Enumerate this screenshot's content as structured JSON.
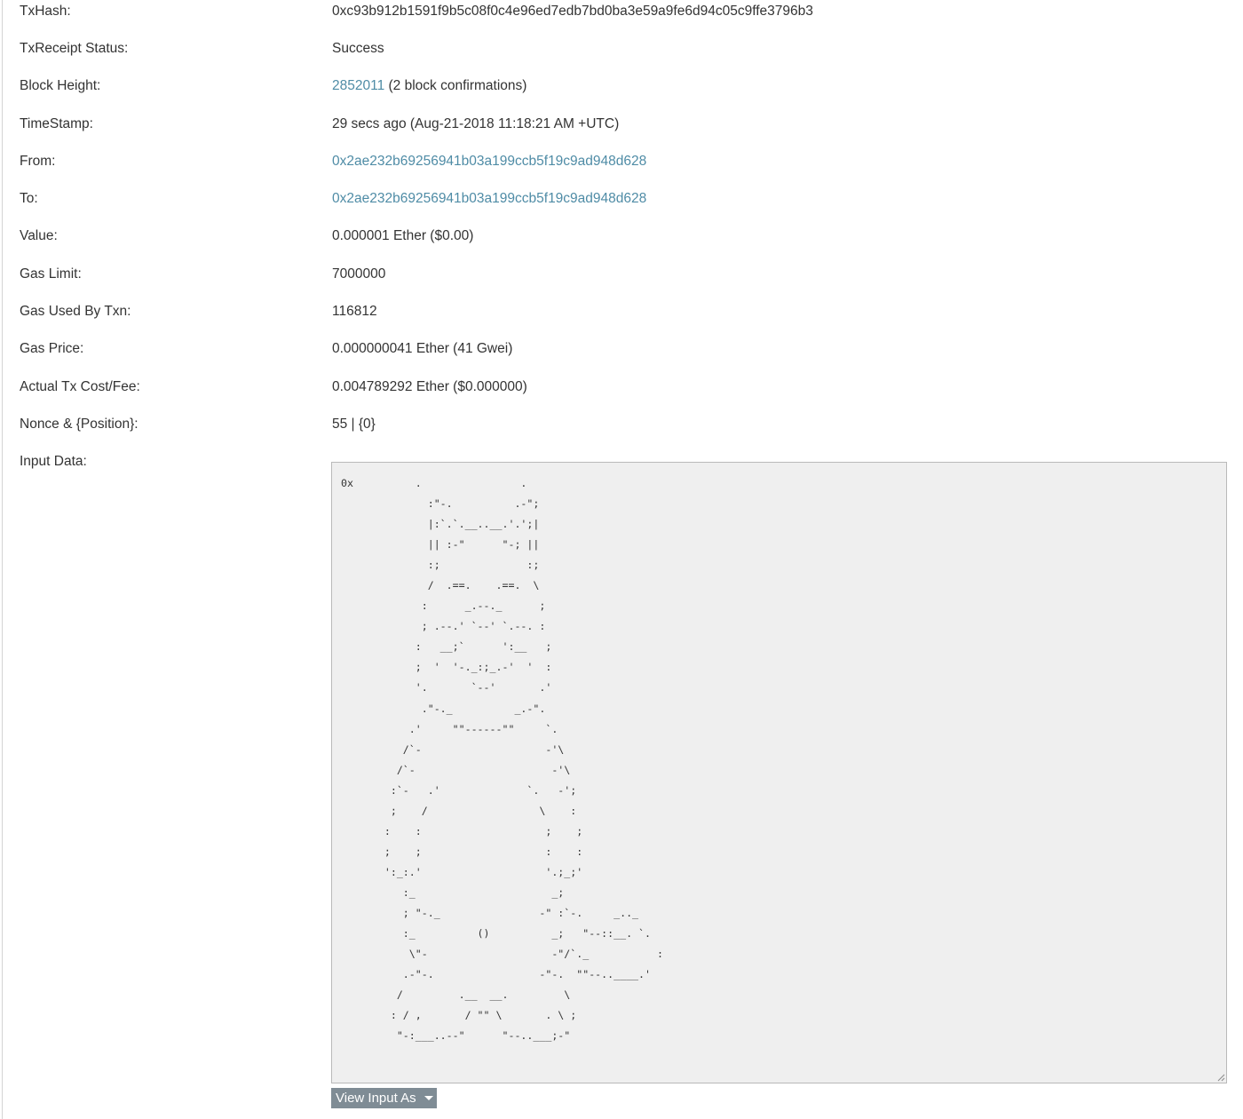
{
  "fields": {
    "txhash": {
      "label": "TxHash:",
      "value": "0xc93b912b1591f9b5c08f0c4e96ed7edb7bd0ba3e59a9fe6d94c05c9ffe3796b3"
    },
    "receipt_status": {
      "label": "TxReceipt Status:",
      "value": "Success"
    },
    "block_height": {
      "label": "Block Height:",
      "block": "2852011",
      "confirmations": " (2 block confirmations)"
    },
    "timestamp": {
      "label": "TimeStamp:",
      "value": "29 secs ago (Aug-21-2018 11:18:21 AM +UTC)"
    },
    "from": {
      "label": "From:",
      "address": "0x2ae232b69256941b03a199ccb5f19c9ad948d628"
    },
    "to": {
      "label": "To:",
      "address": "0x2ae232b69256941b03a199ccb5f19c9ad948d628"
    },
    "value": {
      "label": "Value:",
      "value": "0.000001 Ether ($0.00)"
    },
    "gas_limit": {
      "label": "Gas Limit:",
      "value": "7000000"
    },
    "gas_used": {
      "label": "Gas Used By Txn:",
      "value": "116812"
    },
    "gas_price": {
      "label": "Gas Price:",
      "value": "0.000000041 Ether (41 Gwei)"
    },
    "fee": {
      "label": "Actual Tx Cost/Fee:",
      "value": "0.004789292 Ether ($0.000000)"
    },
    "nonce": {
      "label": "Nonce & {Position}:",
      "value": "55 | {0}"
    },
    "input_data": {
      "label": "Input Data:",
      "value": "0x          .                .\n              :\"-.          .-\";\n              |:`.`.__..__.'.';|\n              || :-\"      \"-; ||\n              :;              :;\n              /  .==.    .==.  \\\n             :      _.--._      ;\n             ; .--.' `--' `.--. :\n            :   __;`      ':__   ;\n            ;  '  '-._:;_.-'  '  :\n            '.       `--'       .'\n             .\"-._          _.-\".\n           .'     \"\"------\"\"     `.\n          /`-                    -'\\\n         /`-                      -'\\\n        :`-   .'              `.   -';\n        ;    /                  \\    :\n       :    :                    ;    ;\n       ;    ;                    :    :\n       ':_:.'                    '.;_;'\n          :_                      _;\n          ; \"-._                -\" :`-.     _.._\n          :_          ()          _;   \"--::__. `.\n           \\\"-                    -\"/`._           :\n          .-\"-.                 -\"-.  \"\"--..____.'\n         /         .__  __.         \\\n        : / ,       / \"\" \\       . \\ ;\n         \"-:___..--\"      \"--..___;-\""
    }
  },
  "view_input_button": {
    "label": "View Input As"
  },
  "icons": {
    "dropdown": "caret-down-icon",
    "resize": "resize-handle-icon"
  },
  "colors": {
    "link": "#4f8ca6",
    "button_bg": "#7f8c95",
    "input_bg": "#efefef"
  }
}
